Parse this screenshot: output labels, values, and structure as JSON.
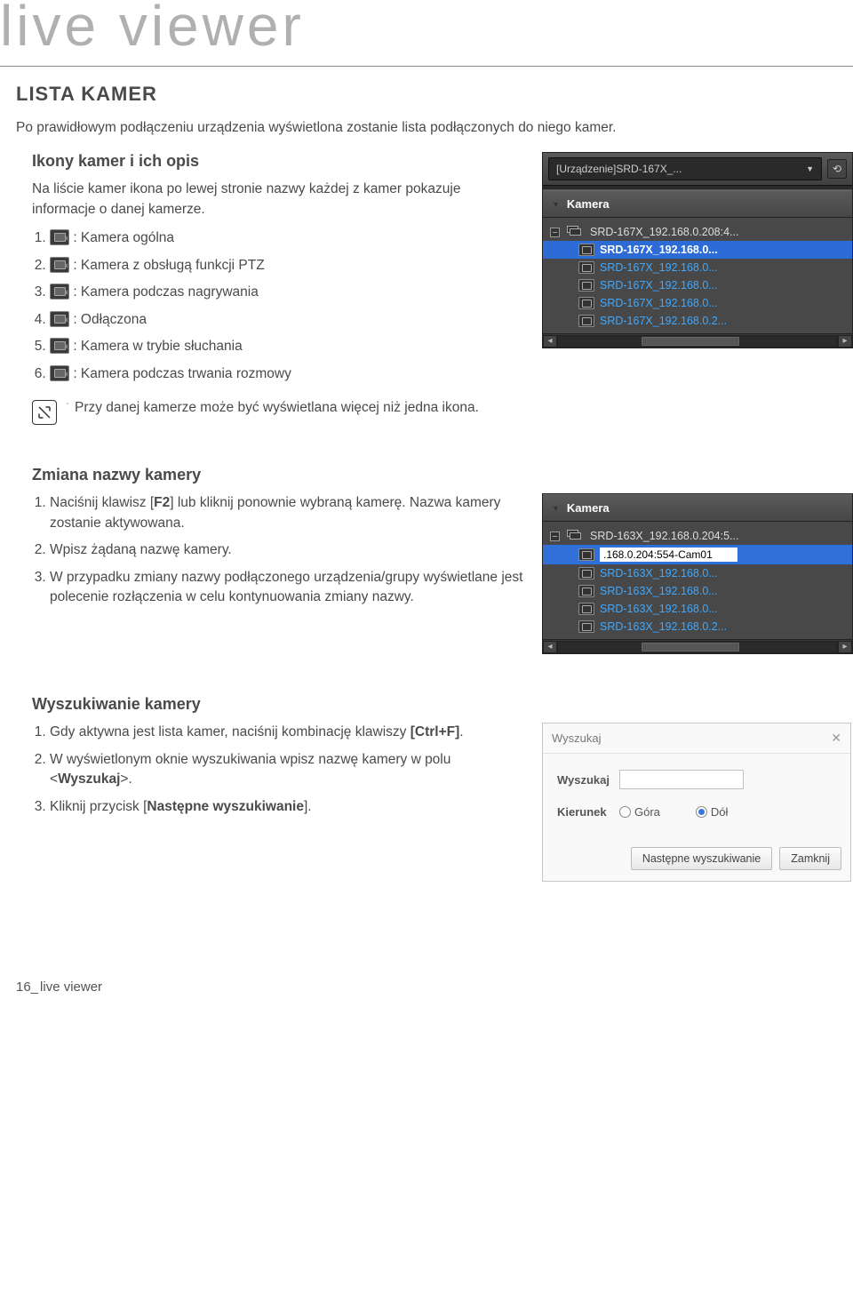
{
  "page_title": "live viewer",
  "section_heading": "LISTA KAMER",
  "intro": "Po prawidłowym podłączeniu urządzenia wyświetlona zostanie lista podłączonych do niego kamer.",
  "icons_section": {
    "heading": "Ikony kamer i ich opis",
    "lead": "Na liście kamer ikona po lewej stronie nazwy każdej z kamer pokazuje informacje o danej kamerze.",
    "items": [
      ": Kamera ogólna",
      ": Kamera z obsługą funkcji PTZ",
      ": Kamera podczas nagrywania",
      ": Odłączona",
      ": Kamera w trybie słuchania",
      ": Kamera podczas trwania rozmowy"
    ],
    "note": "Przy danej kamerze może być wyświetlana więcej niż jedna ikona."
  },
  "panel1": {
    "device_combo": "[Urządzenie]SRD-167X_...",
    "section_label": "Kamera",
    "root": "SRD-167X_192.168.0.208:4...",
    "items": [
      "SRD-167X_192.168.0...",
      "SRD-167X_192.168.0...",
      "SRD-167X_192.168.0...",
      "SRD-167X_192.168.0...",
      "SRD-167X_192.168.0.2..."
    ],
    "selected_index": 0
  },
  "rename_section": {
    "heading": "Zmiana nazwy kamery",
    "steps": [
      "Naciśnij klawisz [F2] lub kliknij ponownie wybraną kamerę. Nazwa kamery zostanie aktywowana.",
      "Wpisz żądaną nazwę kamery.",
      "W przypadku zmiany nazwy podłączonego urządzenia/grupy wyświetlane jest polecenie rozłączenia w celu kontynuowania zmiany nazwy."
    ],
    "keys": {
      "f2": "F2"
    }
  },
  "panel2": {
    "section_label": "Kamera",
    "root": "SRD-163X_192.168.0.204:5...",
    "edit_value": ".168.0.204:554-Cam01",
    "items": [
      "SRD-163X_192.168.0...",
      "SRD-163X_192.168.0...",
      "SRD-163X_192.168.0...",
      "SRD-163X_192.168.0.2..."
    ]
  },
  "search_section": {
    "heading": "Wyszukiwanie kamery",
    "steps": [
      "Gdy aktywna jest lista kamer, naciśnij kombinację klawiszy",
      "W wyświetlonym oknie wyszukiwania wpisz nazwę kamery w polu <",
      "Kliknij przycisk ["
    ],
    "step1_key": "[Ctrl+F]",
    "step2_field": "Wyszukaj",
    "step2_tail": ">.",
    "step3_btn": "Następne wyszukiwanie",
    "step3_tail": "]."
  },
  "search_win": {
    "title": "Wyszukaj",
    "field_label": "Wyszukaj",
    "dir_label": "Kierunek",
    "opt_up": "Góra",
    "opt_down": "Dół",
    "btn_next": "Następne wyszukiwanie",
    "btn_close": "Zamknij"
  },
  "footer": {
    "page_num": "16_",
    "label": "live viewer"
  }
}
